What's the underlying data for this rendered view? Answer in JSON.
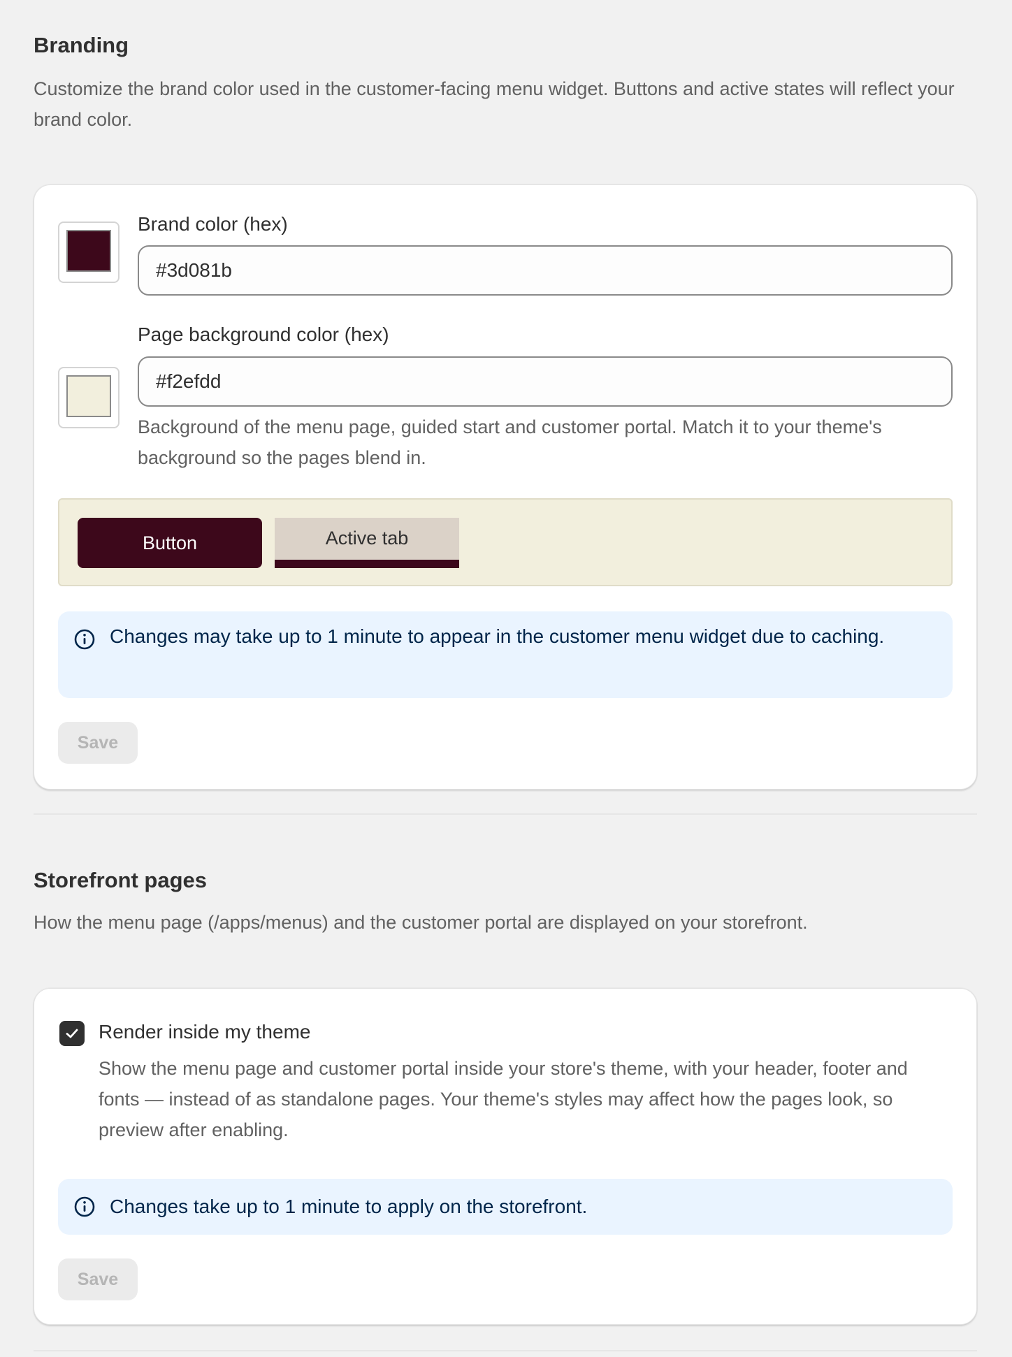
{
  "branding": {
    "title": "Branding",
    "description": "Customize the brand color used in the customer-facing menu widget. Buttons and active states will reflect your brand color.",
    "brand_color": {
      "label": "Brand color (hex)",
      "value": "#3d081b",
      "swatch": "#3d081b"
    },
    "background_color": {
      "label": "Page background color (hex)",
      "value": "#f2efdd",
      "swatch": "#f2efdd",
      "help": "Background of the menu page, guided start and customer portal. Match it to your theme's background so the pages blend in."
    },
    "preview": {
      "button_label": "Button",
      "tab_label": "Active tab",
      "background": "#f2efdd",
      "brand": "#3d081b"
    },
    "banner": {
      "icon": "info-icon",
      "text": "Changes may take up to 1 minute to appear in the customer menu widget due to caching."
    },
    "save_label": "Save"
  },
  "storefront": {
    "title": "Storefront pages",
    "description": "How the menu page (/apps/menus) and the customer portal are displayed on your storefront.",
    "render_inside_theme": {
      "label": "Render inside my theme",
      "checked": true,
      "help": "Show the menu page and customer portal inside your store's theme, with your header, footer and fonts — instead of as standalone pages. Your theme's styles may affect how the pages look, so preview after enabling."
    },
    "banner": {
      "icon": "info-icon",
      "text": "Changes take up to 1 minute to apply on the storefront."
    },
    "save_label": "Save"
  }
}
